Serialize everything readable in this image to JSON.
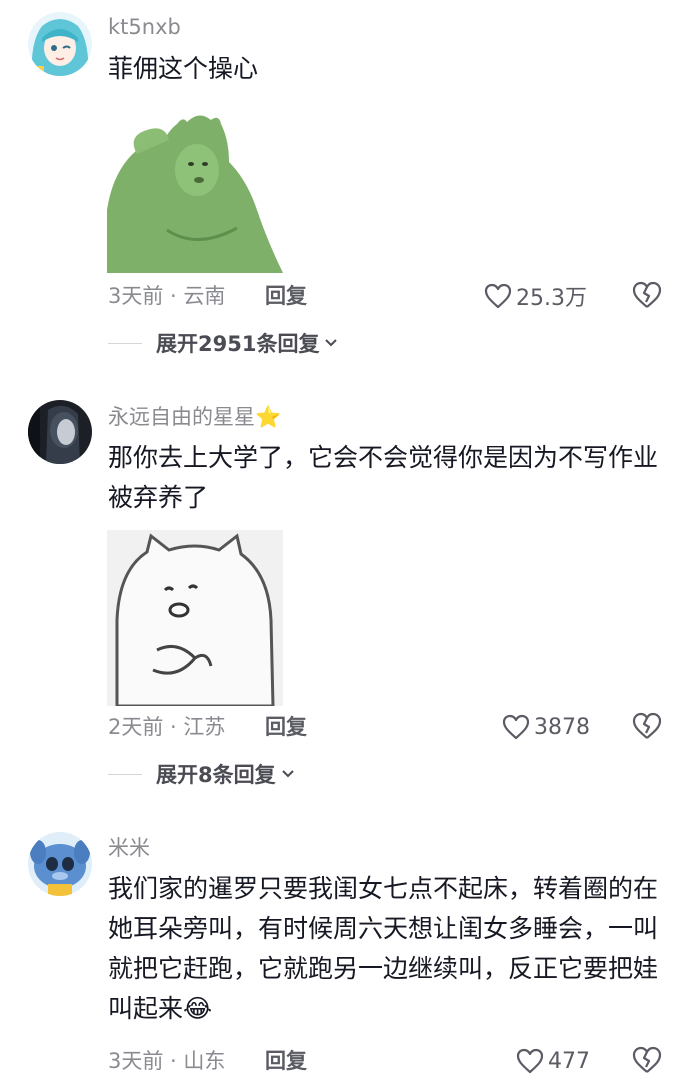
{
  "comments": [
    {
      "username": "kt5nxb",
      "text": "菲佣这个操心",
      "time": "3天前",
      "location": "云南",
      "reply_label": "回复",
      "likes": "25.3万",
      "expand_label": "展开2951条回复"
    },
    {
      "username": "永远自由的星星⭐",
      "text": "那你去上大学了，它会不会觉得你是因为不写作业被弃养了",
      "time": "2天前",
      "location": "江苏",
      "reply_label": "回复",
      "likes": "3878",
      "expand_label": "展开8条回复"
    },
    {
      "username": "米米",
      "text": "我们家的暹罗只要我闺女七点不起床，转着圈的在她耳朵旁叫，有时候周六天想让闺女多睡会，一叫就把它赶跑，它就跑另一边继续叫，反正它要把娃叫起来",
      "emoji": "😂",
      "time": "3天前",
      "location": "山东",
      "reply_label": "回复",
      "likes": "477"
    }
  ],
  "meta_separator": " · ",
  "colors": {
    "text": "#161823",
    "secondary": "#8a8b91",
    "action": "#5a5b63",
    "sticker_green": "#7fb069"
  },
  "icons": [
    "heart-outline-icon",
    "broken-heart-icon",
    "chevron-down-icon"
  ]
}
